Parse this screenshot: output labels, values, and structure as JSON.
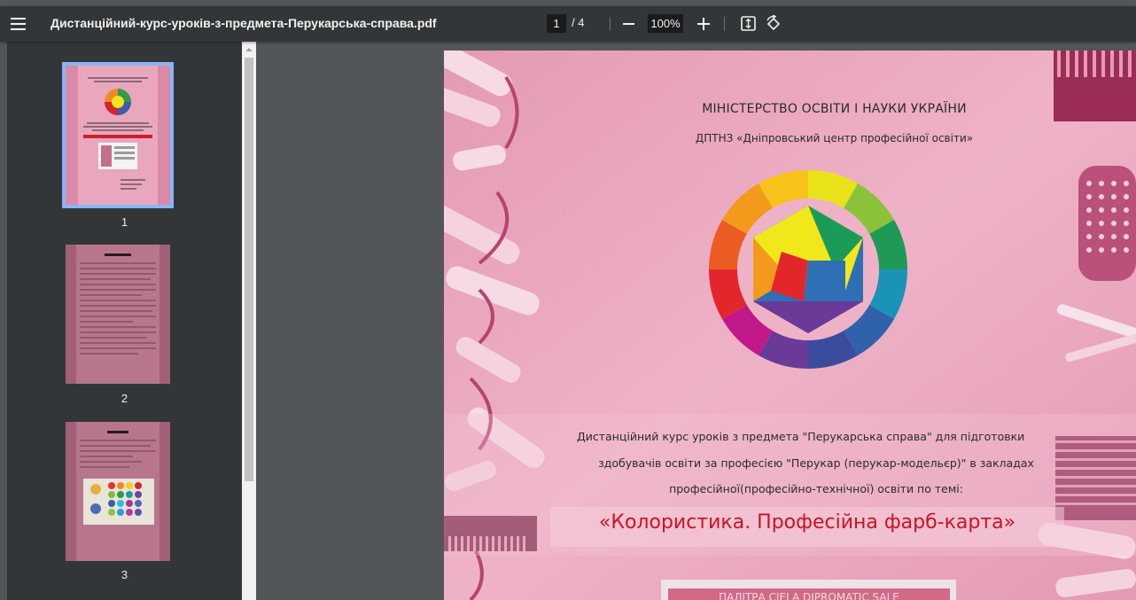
{
  "toolbar": {
    "title": "Дистанційний-курс-уроків-з-предмета-Перукарська-справа.pdf",
    "page_current": "1",
    "page_total": "/ 4",
    "zoom": "100%"
  },
  "sidebar": {
    "thumbnails": [
      {
        "label": "1"
      },
      {
        "label": "2"
      },
      {
        "label": "3"
      }
    ]
  },
  "page": {
    "ministry": "МІНІСТЕРСТВО ОСВІТИ І НАУКИ УКРАЇНИ",
    "center": "ДПТНЗ «Дніпровський центр професійної освіти»",
    "desc_line1": "Дистанційний курс уроків з предмета \"Перукарська справа\" для підготовки",
    "desc_line2": "здобувачів освіти за професією \"Перукар (перукар-модельєр)\" в закладах",
    "desc_line3": "професійної(професійно-технічної) освіти по темі:",
    "topic": "«Колористика. Професійна фарб-карта»",
    "bottom_partial": "ПАЛІТРА CIELA DIPROMATIC SALE"
  },
  "colors": {
    "toolbar": "#323639",
    "viewer_bg": "#525659",
    "page_pink": "#eaa5bc",
    "topic_red": "#c81424",
    "selected_outline": "#8ab4f8"
  },
  "icons": [
    "menu-icon",
    "minus-icon",
    "plus-icon",
    "fit-to-page-icon",
    "rotate-icon",
    "scroll-up-arrow-icon"
  ]
}
